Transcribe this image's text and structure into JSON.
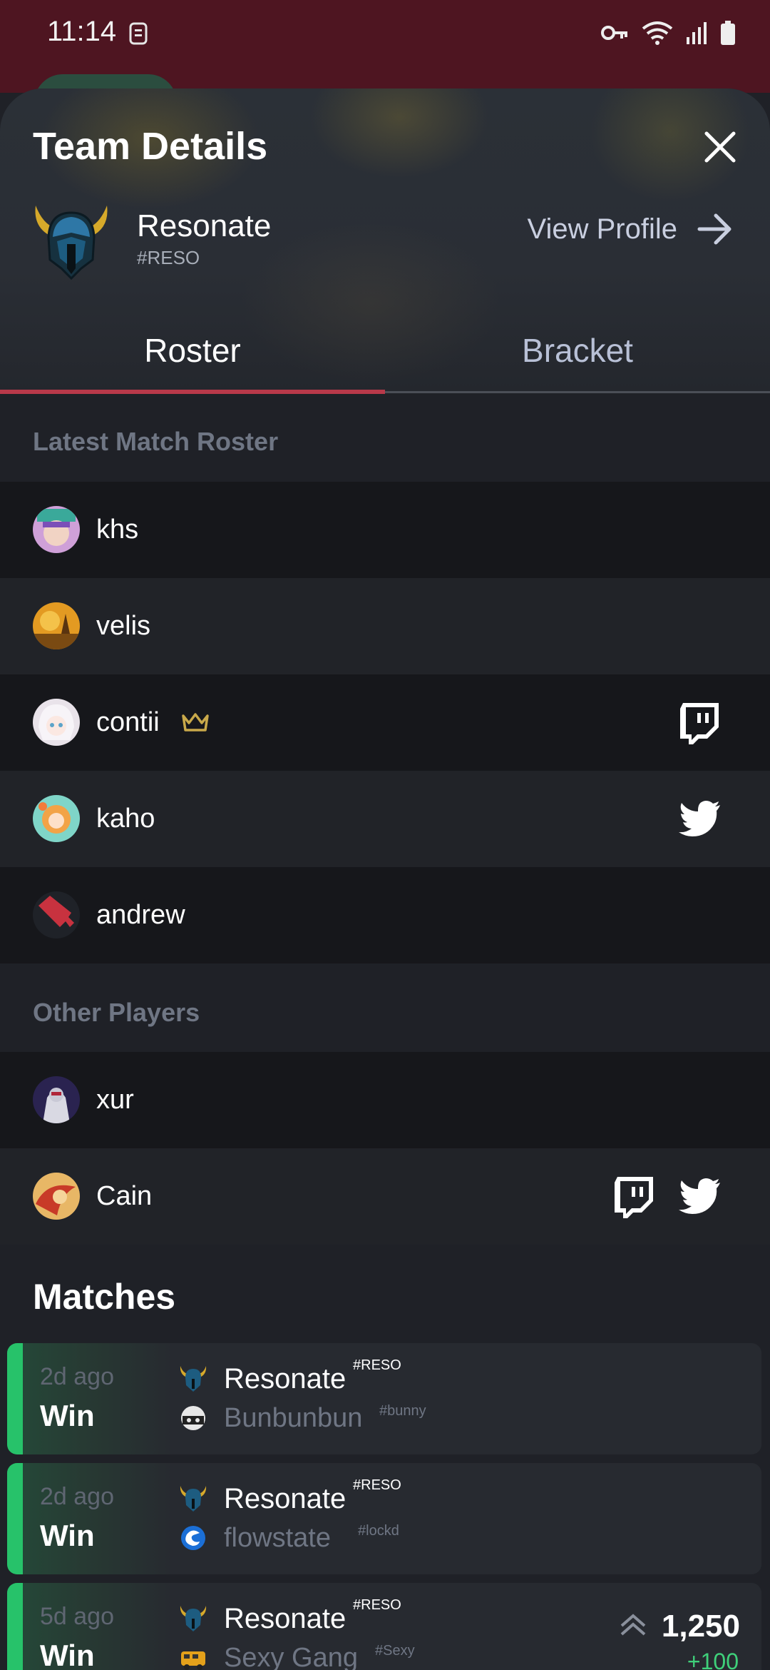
{
  "status_bar": {
    "time": "11:14"
  },
  "sheet": {
    "title": "Team Details",
    "team": {
      "name": "Resonate",
      "tag": "#RESO"
    },
    "view_profile_label": "View Profile"
  },
  "tabs": [
    {
      "label": "Roster",
      "active": true
    },
    {
      "label": "Bracket",
      "active": false
    }
  ],
  "roster": {
    "latest_label": "Latest Match Roster",
    "latest": [
      {
        "name": "khs",
        "avatar": "avatar-khs",
        "socials": []
      },
      {
        "name": "velis",
        "avatar": "avatar-velis",
        "socials": []
      },
      {
        "name": "contii",
        "avatar": "avatar-contii",
        "captain": true,
        "socials": [
          "twitch-icon"
        ]
      },
      {
        "name": "kaho",
        "avatar": "avatar-kaho",
        "socials": [
          "twitter-icon"
        ]
      },
      {
        "name": "andrew",
        "avatar": "avatar-andrew",
        "socials": []
      }
    ],
    "other_label": "Other Players",
    "others": [
      {
        "name": "xur",
        "avatar": "avatar-xur",
        "socials": []
      },
      {
        "name": "Cain",
        "avatar": "avatar-cain",
        "socials": [
          "twitch-icon",
          "twitter-icon"
        ]
      }
    ]
  },
  "matches": {
    "title": "Matches",
    "items": [
      {
        "time": "2d ago",
        "result": "Win",
        "team1": "Resonate",
        "tag1": "#RESO",
        "team2": "Bunbunbun",
        "tag2": "#bunny"
      },
      {
        "time": "2d ago",
        "result": "Win",
        "team1": "Resonate",
        "tag1": "#RESO",
        "team2": "flowstate",
        "tag2": "#lockd"
      },
      {
        "time": "5d ago",
        "result": "Win",
        "team1": "Resonate",
        "tag1": "#RESO",
        "team2": "Sexy Gang",
        "tag2": "#Sexy",
        "score": "1,250",
        "delta": "+100"
      }
    ]
  },
  "colors": {
    "accent": "#b8394a",
    "win": "#27c26a",
    "status_bar": "#4e1521"
  }
}
